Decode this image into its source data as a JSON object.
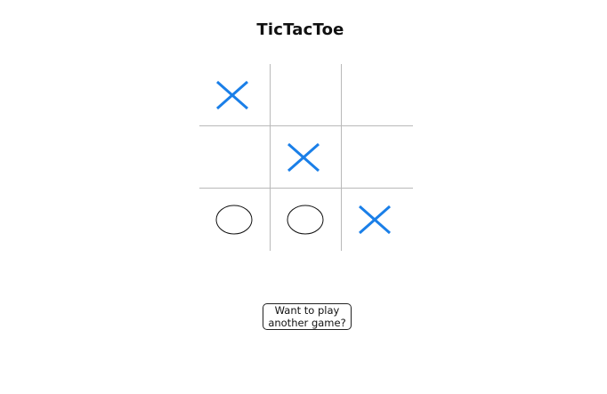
{
  "game": {
    "title": "TicTacToe",
    "board": [
      [
        "X",
        "",
        ""
      ],
      [
        "",
        "X",
        ""
      ],
      [
        "O",
        "O",
        "X"
      ]
    ],
    "colors": {
      "x_mark": "#1a7fe8",
      "o_mark": "#111111",
      "grid": "#b9b9b9"
    },
    "icons": {
      "x": "x-mark-icon",
      "o": "o-mark-icon"
    }
  },
  "restart_button": {
    "line1": "Want to play",
    "line2": "another game?"
  }
}
